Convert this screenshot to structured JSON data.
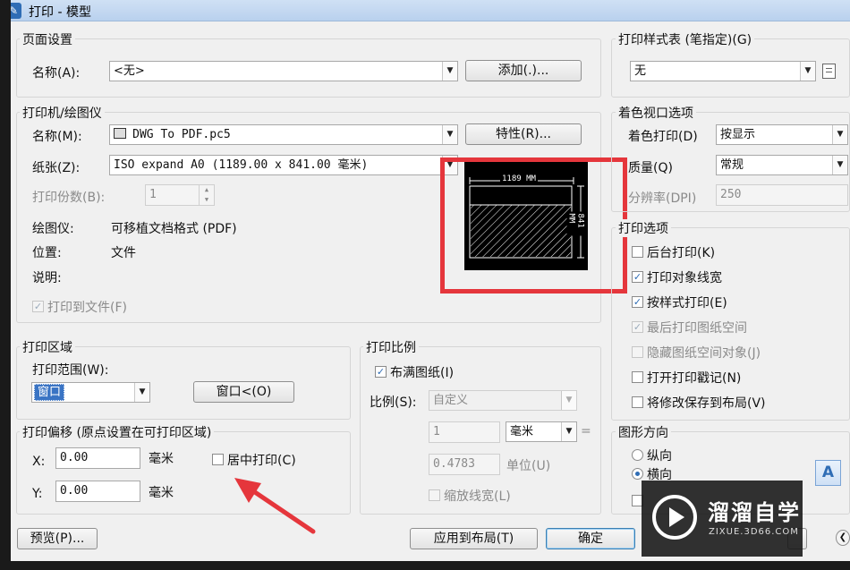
{
  "window": {
    "title": "打印 - 模型"
  },
  "page_setup": {
    "legend": "页面设置",
    "name_label": "名称(A):",
    "name_value": "<无>",
    "add_button": "添加(.)..."
  },
  "printer": {
    "legend": "打印机/绘图仪",
    "name_label": "名称(M):",
    "name_value": "DWG To PDF.pc5",
    "properties_button": "特性(R)...",
    "paper_label": "纸张(Z):",
    "paper_value": "ISO expand A0 (1189.00 x 841.00 毫米)",
    "copies_label": "打印份数(B):",
    "copies_value": "1",
    "plotter_label": "绘图仪:",
    "plotter_value": "可移植文档格式 (PDF)",
    "location_label": "位置:",
    "location_value": "文件",
    "description_label": "说明:",
    "print_to_file_label": "打印到文件(F)",
    "preview_width": "1189 MM",
    "preview_height": "841 MM"
  },
  "print_area": {
    "legend": "打印区域",
    "range_label": "打印范围(W):",
    "range_value": "窗口",
    "window_button": "窗口<(O)"
  },
  "print_offset": {
    "legend": "打印偏移 (原点设置在可打印区域)",
    "x_label": "X:",
    "x_value": "0.00",
    "x_unit": "毫米",
    "y_label": "Y:",
    "y_value": "0.00",
    "y_unit": "毫米",
    "center_label": "居中打印(C)"
  },
  "print_scale": {
    "legend": "打印比例",
    "fit_label": "布满图纸(I)",
    "scale_label": "比例(S):",
    "scale_value": "自定义",
    "value1": "1",
    "unit_value": "毫米",
    "equals": "=",
    "value2": "0.4783",
    "unit_label": "单位(U)",
    "scale_lineweights": "缩放线宽(L)"
  },
  "plot_style": {
    "legend": "打印样式表 (笔指定)(G)",
    "value": "无"
  },
  "shaded_viewport": {
    "legend": "着色视口选项",
    "shade_label": "着色打印(D)",
    "shade_value": "按显示",
    "quality_label": "质量(Q)",
    "quality_value": "常规",
    "dpi_label": "分辨率(DPI)",
    "dpi_value": "250"
  },
  "plot_options": {
    "legend": "打印选项",
    "items": [
      {
        "label": "后台打印(K)"
      },
      {
        "label": "打印对象线宽"
      },
      {
        "label": "按样式打印(E)"
      },
      {
        "label": "最后打印图纸空间"
      },
      {
        "label": "隐藏图纸空间对象(J)"
      },
      {
        "label": "打开打印戳记(N)"
      },
      {
        "label": "将修改保存到布局(V)"
      }
    ]
  },
  "orientation": {
    "legend": "图形方向",
    "portrait": "纵向",
    "landscape": "横向",
    "icon_letter": "A"
  },
  "footer": {
    "preview_button": "预览(P)...",
    "apply_button": "应用到布局(T)",
    "ok_button": "确定"
  },
  "watermark": {
    "brand": "溜溜自学",
    "site": "ZIXUE.3D66.COM"
  },
  "colors": {
    "annotation_red": "#e5363c",
    "accent_blue": "#2f6db5"
  }
}
